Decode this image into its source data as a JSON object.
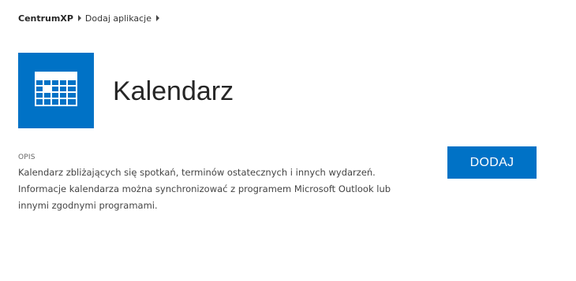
{
  "breadcrumb": {
    "root": "CentrumXP",
    "current": "Dodaj aplikacje"
  },
  "app": {
    "title": "Kalendarz",
    "tile_color": "#0072c6",
    "icon": "calendar-icon"
  },
  "description": {
    "heading": "OPIS",
    "lines": [
      "Kalendarz zbliżających się spotkań, terminów ostatecznych i innych wydarzeń.",
      "Informacje kalendarza można synchronizować z programem Microsoft Outlook lub",
      "innymi zgodnymi programami."
    ]
  },
  "actions": {
    "add_label": "DODAJ",
    "add_color": "#0072c6"
  }
}
